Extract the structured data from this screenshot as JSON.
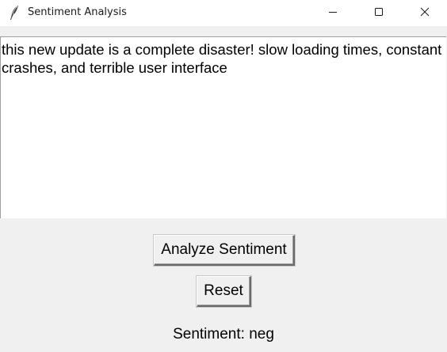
{
  "window": {
    "title": "Sentiment Analysis",
    "app_icon": "feather-icon",
    "controls": {
      "minimize_icon": "minimize-icon",
      "maximize_icon": "maximize-icon",
      "close_icon": "close-icon"
    }
  },
  "input": {
    "value": "this new update is a complete disaster! slow loading times, constant crashes, and terrible user interface"
  },
  "buttons": {
    "analyze_label": "Analyze Sentiment",
    "reset_label": "Reset"
  },
  "result": {
    "text": "Sentiment: neg"
  },
  "colors": {
    "window_bg": "#f0f0f0",
    "titlebar_bg": "#ffffff",
    "text_area_bg": "#ffffff"
  }
}
